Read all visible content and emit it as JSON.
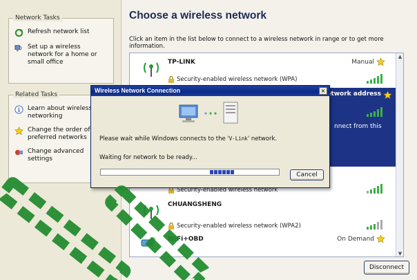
{
  "sidebar": {
    "network_tasks": {
      "title": "Network Tasks",
      "items": [
        {
          "label": "Refresh network list",
          "icon": "refresh-icon"
        },
        {
          "label": "Set up a wireless network for a home or small office",
          "icon": "setup-network-icon"
        }
      ]
    },
    "related_tasks": {
      "title": "Related Tasks",
      "items": [
        {
          "label": "Learn about wireless networking",
          "icon": "info-icon"
        },
        {
          "label": "Change the order of preferred networks",
          "icon": "star-icon"
        },
        {
          "label": "Change advanced settings",
          "icon": "settings-icon"
        }
      ]
    }
  },
  "main": {
    "title": "Choose a wireless network",
    "description": "Click an item in the list below to connect to a wireless network in range or to get more information.",
    "networks": [
      {
        "name": "TP-LINK",
        "status": "Manual",
        "security": "Security-enabled wireless network (WPA)"
      },
      {
        "name": "",
        "status": "quiring network address",
        "security": "",
        "detail": "nnect from this"
      },
      {
        "name": "",
        "status": "",
        "security": "Security-enabled wireless network"
      },
      {
        "name": "CHUANGSHENG",
        "status": "",
        "security": "Security-enabled wireless network (WPA2)"
      },
      {
        "name": "WiFi+OBD",
        "status": "On Demand",
        "security": ""
      }
    ],
    "disconnect_label": "Disconnect"
  },
  "dialog": {
    "title": "Wireless Network Connection",
    "close_label": "×",
    "message_prefix": "Please wait while Windows connects to the '",
    "network_name": "V-Link",
    "message_suffix": "' network.",
    "waiting_text": "Waiting for network to be ready...",
    "progress_blocks": 6,
    "cancel_label": "Cancel"
  },
  "colors": {
    "selected_row": "#1d3486",
    "title_text": "#1b2a55",
    "dialog_titlebar": "#0a2a8a",
    "watermark": "#1e8a2c"
  }
}
